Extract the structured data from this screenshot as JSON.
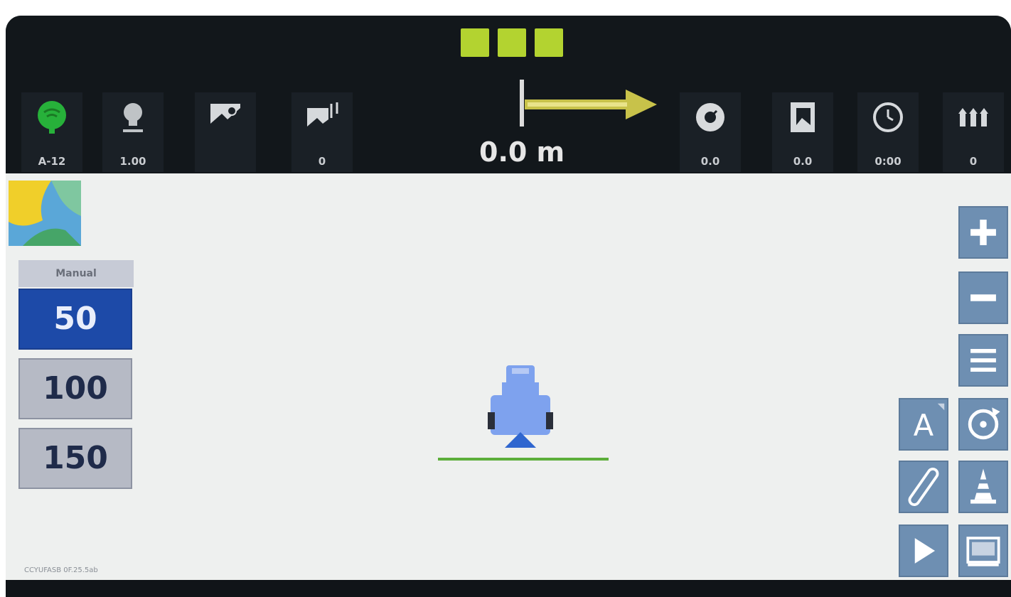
{
  "status_indicators": [
    "",
    "",
    ""
  ],
  "top_bar": {
    "left_items": [
      {
        "icon": "gps-signal-icon",
        "value": "A-12"
      },
      {
        "icon": "lightbulb-icon",
        "value": "1.00"
      },
      {
        "icon": "field-map-icon",
        "value": ""
      },
      {
        "icon": "field-flags-icon",
        "value": "0"
      }
    ],
    "right_items": [
      {
        "icon": "speedometer-icon",
        "value": "0.0"
      },
      {
        "icon": "document-area-icon",
        "value": "0.0"
      },
      {
        "icon": "clock-icon",
        "value": "0:00"
      },
      {
        "icon": "sections-icon",
        "value": "0"
      }
    ]
  },
  "guidance": {
    "distance": "0.0 m",
    "arrow_color": "#c8c24a"
  },
  "zoom_panel": {
    "label": "Manual",
    "options": [
      "50",
      "100",
      "150"
    ],
    "selected": "50"
  },
  "right_buttons": [
    "zoom-in-icon",
    "zoom-out-icon",
    "menu-icon",
    "auto-steer-icon",
    "recenter-icon",
    "line-icon",
    "cone-icon",
    "play-icon",
    "screen-icon"
  ],
  "file_stamp": "CCYUFASB 0F.25.5ab",
  "colors": {
    "accent_green": "#b3d330",
    "selected_blue": "#1d4aa8",
    "button_blue": "#6e8fb2",
    "vehicle_blue": "#7ea2ee"
  }
}
